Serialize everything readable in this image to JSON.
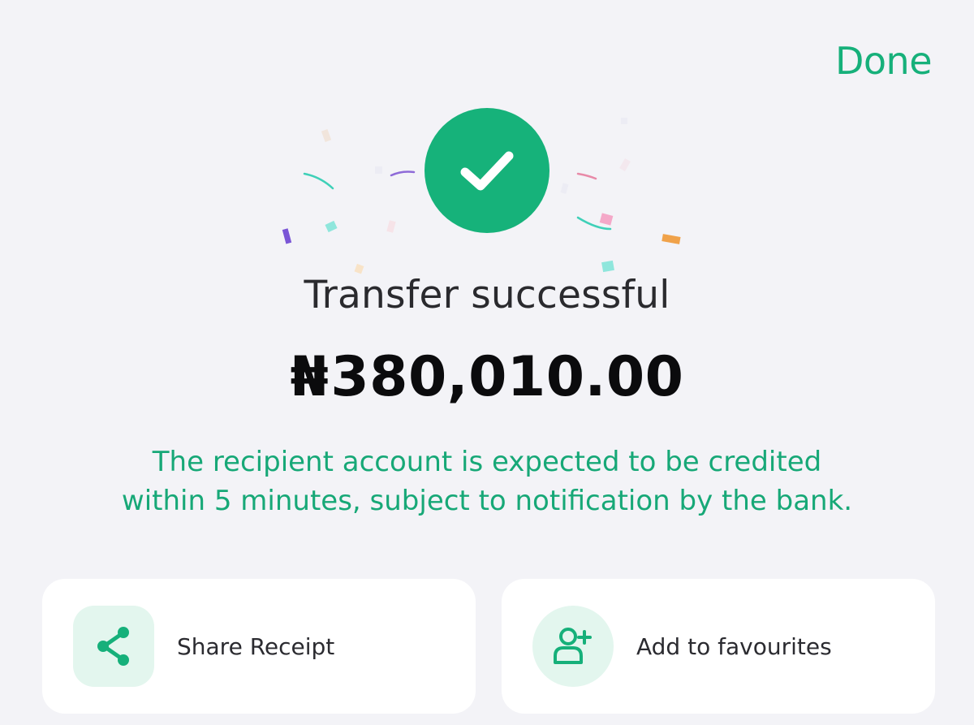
{
  "header": {
    "done_label": "Done"
  },
  "status": {
    "title": "Transfer successful",
    "currency_symbol": "₦",
    "amount": "380,010.00",
    "notice": "The recipient account is expected to be credited within 5 minutes, subject to notification by the bank."
  },
  "actions": {
    "share_label": "Share Receipt",
    "favourite_label": "Add to favourites"
  },
  "icons": {
    "success": "check-circle-icon",
    "share": "share-icon",
    "add_favourite": "add-user-icon"
  },
  "colors": {
    "accent": "#16b07a",
    "background": "#f3f3f7",
    "card": "#ffffff",
    "icon_bg": "#e3f6ee"
  }
}
